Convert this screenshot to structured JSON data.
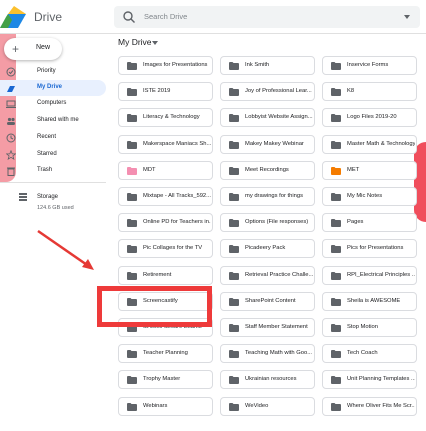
{
  "header": {
    "brand": "Drive",
    "search_placeholder": "Search Drive"
  },
  "sidebar": {
    "new_label": "New",
    "items": [
      {
        "label": "Priority",
        "icon": "check-circle-icon",
        "active": false
      },
      {
        "label": "My Drive",
        "icon": "drive-icon",
        "active": true
      },
      {
        "label": "Computers",
        "icon": "computer-icon",
        "active": false
      },
      {
        "label": "Shared with me",
        "icon": "people-icon",
        "active": false
      },
      {
        "label": "Recent",
        "icon": "clock-icon",
        "active": false
      },
      {
        "label": "Starred",
        "icon": "star-icon",
        "active": false
      },
      {
        "label": "Trash",
        "icon": "trash-icon",
        "active": false
      }
    ],
    "storage_label": "Storage",
    "storage_value": "124.6 GB used"
  },
  "main": {
    "title": "My Drive",
    "folders": [
      [
        "Images for Presentations",
        "Ink Smith",
        "Inservice Forms"
      ],
      [
        "ISTE 2019",
        "Joy of Professional Lear...",
        "K8"
      ],
      [
        "Literacy & Technology",
        "Lobbyist Website Assign...",
        "Logo Files 2019-20"
      ],
      [
        "Makerspace Maniacs Sh...",
        "Makey Makey Webinar",
        "Master Math & Technology"
      ],
      [
        "MDT",
        "Meet Recordings",
        "MET"
      ],
      [
        "Mixtape - All Tracks_592...",
        "my drawings for things",
        "My Mic Notes"
      ],
      [
        "Online PD for Teachers in...",
        "Options (File responses)",
        "Pages"
      ],
      [
        "Pic Collages for the TV",
        "Picadeery Pack",
        "Pics for Presentations"
      ],
      [
        "Retirement",
        "Retrieval Practice Challe...",
        "RPI_Electrical Principles ..."
      ],
      [
        "Screencastify",
        "SharePoint Content",
        "Sheila is AWESOME"
      ],
      [
        "St Joes Secure Exams",
        "Staff Member Statement",
        "Stop Motion"
      ],
      [
        "Teacher Planning",
        "Teaching Math with Goo...",
        "Tech Coach"
      ],
      [
        "Trophy Master",
        "Ukrainian resources",
        "Unit Planning Templates ..."
      ],
      [
        "Webinars",
        "WeVideo",
        "Where Oliver Fits Me Scr..."
      ]
    ],
    "folder_colors": {
      "default": "#5f6368",
      "MDT": "#f48fb1",
      "MET": "#f57c00"
    }
  },
  "annotation": {
    "highlight_color": "#ee3a3a",
    "highlight_target": "Screencastify"
  }
}
